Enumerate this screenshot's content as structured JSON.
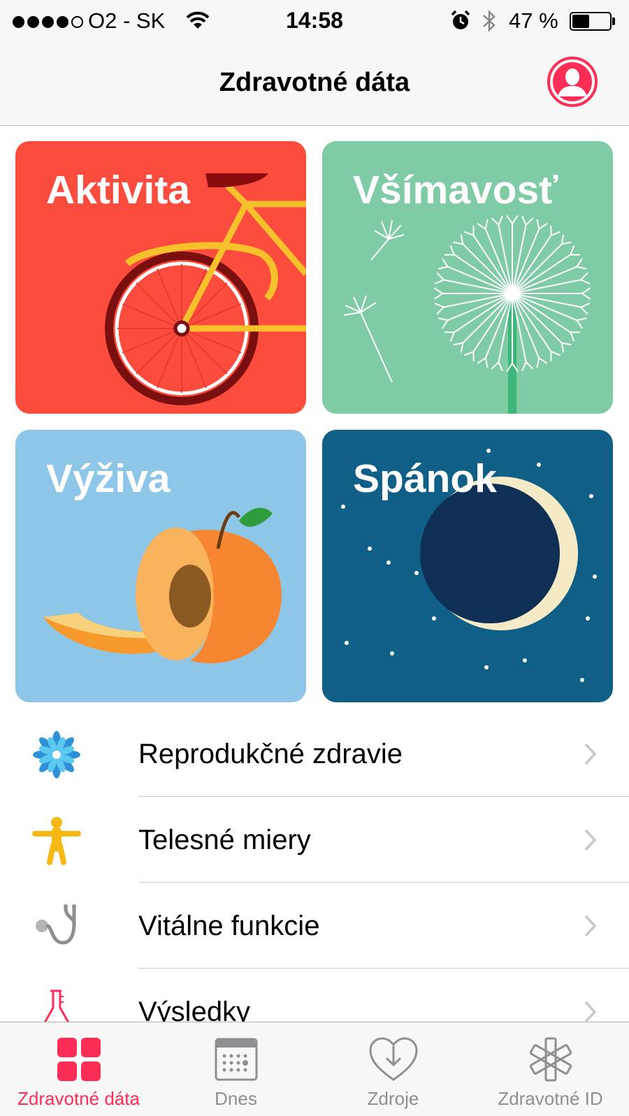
{
  "status_bar": {
    "carrier": "O2 - SK",
    "time": "14:58",
    "battery_percent_text": "47 %",
    "battery_level": 0.47,
    "signal_bars_filled": 4,
    "signal_bars_total": 5
  },
  "nav": {
    "title": "Zdravotné dáta",
    "profile_icon": "person-circle-icon"
  },
  "categories": [
    {
      "label": "Aktivita",
      "color": "#fc4c3d",
      "icon": "bicycle-illustration"
    },
    {
      "label": "Všímavosť",
      "color": "#7fcba5",
      "icon": "dandelion-illustration"
    },
    {
      "label": "Výživa",
      "color": "#8ec6e8",
      "icon": "peach-illustration"
    },
    {
      "label": "Spánok",
      "color": "#0f5f87",
      "icon": "moon-illustration"
    }
  ],
  "list": [
    {
      "label": "Reprodukčné zdravie",
      "icon": "flower-icon",
      "color": "#3aa4e0"
    },
    {
      "label": "Telesné miery",
      "icon": "body-figure-icon",
      "color": "#f6b913"
    },
    {
      "label": "Vitálne funkcie",
      "icon": "stethoscope-icon",
      "color": "#8e8e93"
    },
    {
      "label": "Výsledky",
      "icon": "lab-flask-icon",
      "color": "#fe2d55"
    }
  ],
  "tabs": [
    {
      "label": "Zdravotné dáta",
      "icon": "grid-icon",
      "active": true
    },
    {
      "label": "Dnes",
      "icon": "calendar-icon",
      "active": false
    },
    {
      "label": "Zdroje",
      "icon": "heart-download-icon",
      "active": false
    },
    {
      "label": "Zdravotné ID",
      "icon": "medical-star-icon",
      "active": false
    }
  ],
  "colors": {
    "accent": "#fe2d55",
    "tab_inactive": "#8e8e93",
    "chevron": "#c7c7cc"
  }
}
